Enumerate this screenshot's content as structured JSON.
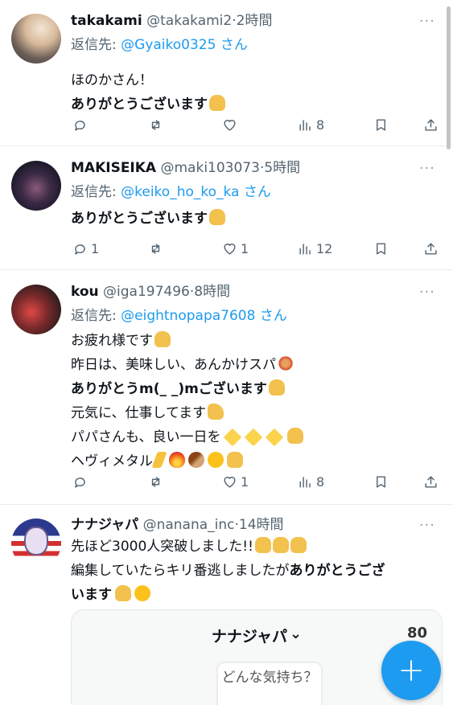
{
  "tweets": [
    {
      "name": "takakami",
      "handle": "@takakami2",
      "time": "2時間",
      "reply_label": "返信先:",
      "reply_to": "@Gyaiko0325 さん",
      "lines": [
        "ほのかさん！",
        "ありがとうございます"
      ],
      "reply_count": "",
      "retweet_count": "",
      "like_count": "",
      "view_count": "8"
    },
    {
      "name": "MAKISEIKA",
      "handle": "@maki103073",
      "time": "5時間",
      "reply_label": "返信先:",
      "reply_to": "@keiko_ho_ko_ka さん",
      "lines": [
        "ありがとうございます"
      ],
      "reply_count": "1",
      "retweet_count": "",
      "like_count": "1",
      "view_count": "12"
    },
    {
      "name": "kou",
      "handle": "@iga197496",
      "time": "8時間",
      "reply_label": "返信先:",
      "reply_to": "@eightnopapa7608 さん",
      "lines": [
        "お疲れ様です",
        "昨日は、美味しい、あんかけスパ",
        "ありがとうm(_ _)mございます",
        "元気に、仕事してます",
        "パパさんも、良い一日を",
        "ヘヴィメタル"
      ],
      "reply_count": "",
      "retweet_count": "",
      "like_count": "1",
      "view_count": "8"
    },
    {
      "name": "ナナジャパ",
      "handle": "@nanana_inc",
      "time": "14時間",
      "lines": [
        "先ほど3000人突破しました!!",
        "編集していたらキリ番逃しましたが",
        "ありがとうござ",
        "います"
      ]
    }
  ],
  "card": {
    "title": "ナナジャパ",
    "chevron": "⌄",
    "right_text": "80",
    "prompt": "どんな気持ち？"
  },
  "fab_label": "+",
  "separator": "·",
  "more_label": "···",
  "colors": {
    "accent": "#1d9bf0",
    "muted": "#536471",
    "text": "#0f1419"
  },
  "icons": [
    "reply-icon",
    "retweet-icon",
    "heart-icon",
    "views-icon",
    "bookmark-icon",
    "share-icon",
    "plus-icon"
  ]
}
